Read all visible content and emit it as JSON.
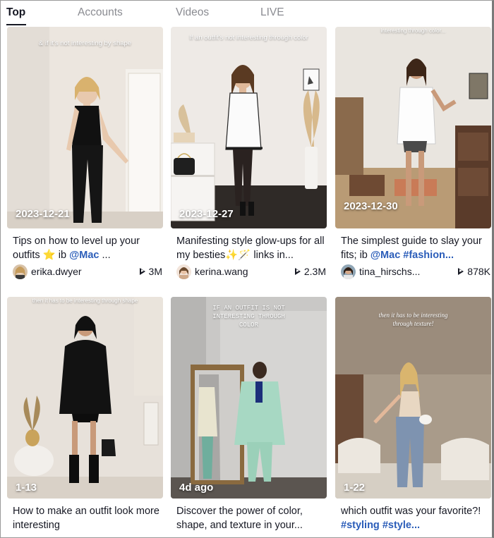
{
  "tabs": [
    {
      "label": "Top",
      "active": true
    },
    {
      "label": "Accounts",
      "active": false
    },
    {
      "label": "Videos",
      "active": false
    },
    {
      "label": "LIVE",
      "active": false
    }
  ],
  "videos": [
    {
      "overlay": "& if it's not interesting by shape",
      "date": "2023-12-21",
      "desc_text": "Tips on how to level up your outfits ⭐ ib ",
      "desc_link": "@Mac",
      "desc_tail": " ...",
      "username": "erika.dwyer",
      "plays": "3M"
    },
    {
      "overlay": "If an outfit's not interesting through color",
      "date": "2023-12-27",
      "desc_text": "Manifesting style glow-ups for all my besties✨🪄 links in...",
      "desc_link": "",
      "desc_tail": "",
      "username": "kerina.wang",
      "plays": "2.3M"
    },
    {
      "overlay": "interesting through color...",
      "date": "2023-12-30",
      "desc_text": "The simplest guide to slay your fits; ib ",
      "desc_link": "@Mac #fashion...",
      "desc_tail": "",
      "username": "tina_hirschs...",
      "plays": "878K"
    },
    {
      "overlay": "then it has to be interesting through shape",
      "date": "1-13",
      "desc_text": "How to make an outfit look more interesting",
      "desc_link": "",
      "desc_tail": "",
      "username": "",
      "plays": ""
    },
    {
      "overlay": "IF AN OUTFIT IS NOT INTERESTING THROUGH COLOR",
      "date": "4d ago",
      "desc_text": "Discover the power of color, shape, and texture in your...",
      "desc_link": "",
      "desc_tail": "",
      "username": "",
      "plays": ""
    },
    {
      "overlay": "then it has to be interesting through texture!",
      "date": "1-22",
      "desc_text": "which outfit was your favorite?! ",
      "desc_link": "#styling #style...",
      "desc_tail": "",
      "username": "",
      "plays": ""
    }
  ],
  "icons": {
    "play": "play-icon"
  }
}
